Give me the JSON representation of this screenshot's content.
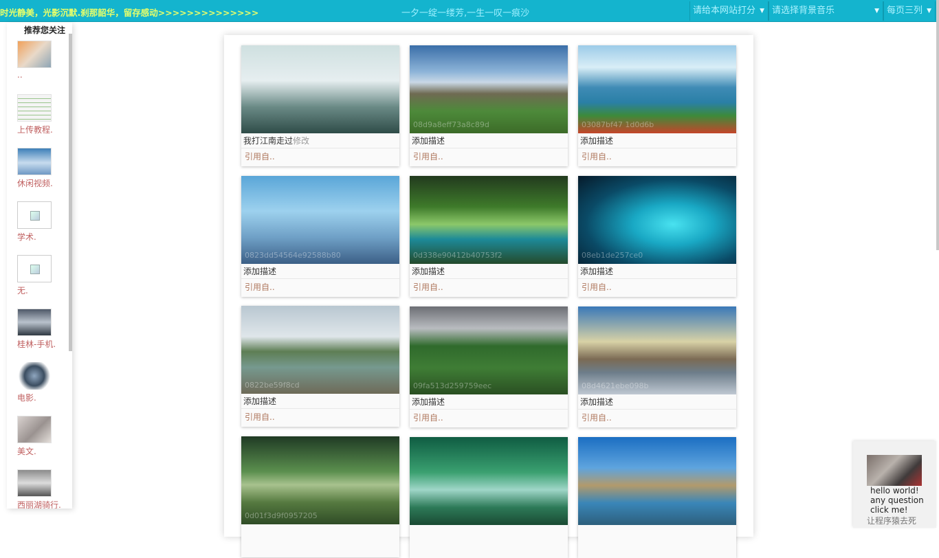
{
  "topbar": {
    "marquee": "时光静美，光影沉默.刹那韶华，留存感动>>>>>>>>>>>>>>",
    "slogan": "一夕一绽一缕芳,一生一叹一痕沙",
    "rate_select": "请给本网站打分",
    "music_select": "请选择背景音乐",
    "columns_select": "每页三列",
    "arrow": "▼"
  },
  "sidebar": {
    "title": "推荐您关注",
    "items": [
      {
        "label": ".."
      },
      {
        "label": "上传教程."
      },
      {
        "label": "休闲视频."
      },
      {
        "label": "学术."
      },
      {
        "label": "无."
      },
      {
        "label": "桂林-手机."
      },
      {
        "label": "电影."
      },
      {
        "label": "美文."
      },
      {
        "label": "西丽湖骑行."
      }
    ]
  },
  "gallery": {
    "cards": [
      {
        "code": "",
        "desc": "我打江南走过",
        "edit": "修改",
        "quote": "引用自.."
      },
      {
        "code": "08d9a8eff73a8c89d",
        "desc": "添加描述",
        "edit": "",
        "quote": "引用自.."
      },
      {
        "code": "03087bf47 1d0d6b",
        "desc": "添加描述",
        "edit": "",
        "quote": "引用自.."
      },
      {
        "code": "0823dd54564e92588b80",
        "desc": "添加描述",
        "edit": "",
        "quote": "引用自.."
      },
      {
        "code": "0d338e90412b40753f2",
        "desc": "添加描述",
        "edit": "",
        "quote": "引用自.."
      },
      {
        "code": "08eb1de257ce0",
        "desc": "添加描述",
        "edit": "",
        "quote": "引用自.."
      },
      {
        "code": "0822be59f8cd",
        "desc": "添加描述",
        "edit": "",
        "quote": "引用自.."
      },
      {
        "code": "09fa513d259759eec",
        "desc": "添加描述",
        "edit": "",
        "quote": "引用自.."
      },
      {
        "code": "08d4621ebe098b",
        "desc": "添加描述",
        "edit": "",
        "quote": "引用自.."
      },
      {
        "code": "0d01f3d9f0957205",
        "desc": "",
        "edit": "",
        "quote": ""
      },
      {
        "code": "",
        "desc": "",
        "edit": "",
        "quote": ""
      },
      {
        "code": "",
        "desc": "",
        "edit": "",
        "quote": ""
      }
    ]
  },
  "chat": {
    "line1": "hello world!",
    "line2": "any question",
    "line3": "click me!",
    "footer": "让程序猿去死"
  }
}
